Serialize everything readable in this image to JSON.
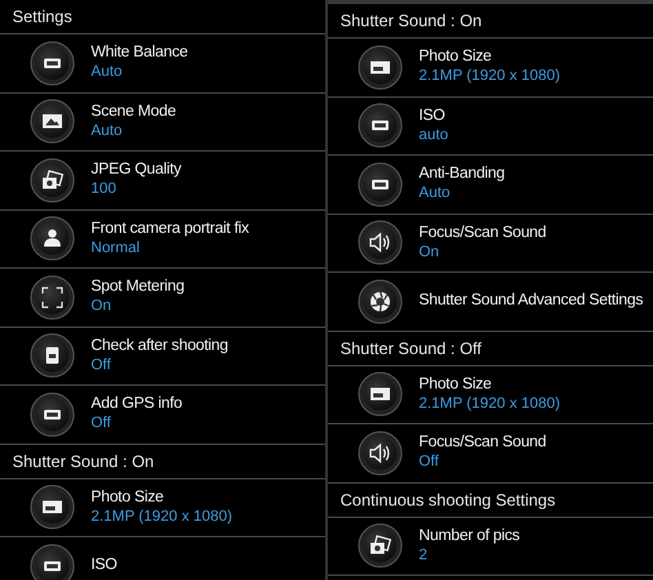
{
  "panels": [
    {
      "entries": [
        {
          "kind": "header",
          "title": "Settings"
        },
        {
          "kind": "item",
          "title": "White Balance",
          "value": "Auto"
        },
        {
          "kind": "item",
          "title": "Scene Mode",
          "value": "Auto"
        },
        {
          "kind": "item",
          "title": "JPEG Quality",
          "value": "100"
        },
        {
          "kind": "item",
          "title": "Front camera portrait fix",
          "value": "Normal"
        },
        {
          "kind": "item",
          "title": "Spot Metering",
          "value": "On"
        },
        {
          "kind": "item",
          "title": "Check after shooting",
          "value": "Off"
        },
        {
          "kind": "item",
          "title": "Add GPS info",
          "value": "Off"
        },
        {
          "kind": "header",
          "title": "Shutter Sound : On"
        },
        {
          "kind": "item",
          "title": "Photo Size",
          "value": "2.1MP (1920 x 1080)"
        },
        {
          "kind": "item",
          "title": "ISO"
        }
      ]
    },
    {
      "entries": [
        {
          "kind": "header",
          "title": "Shutter Sound : On"
        },
        {
          "kind": "item",
          "title": "Photo Size",
          "value": "2.1MP (1920 x 1080)"
        },
        {
          "kind": "item",
          "title": "ISO",
          "value": "auto"
        },
        {
          "kind": "item",
          "title": "Anti-Banding",
          "value": "Auto"
        },
        {
          "kind": "item",
          "title": "Focus/Scan Sound",
          "value": "On"
        },
        {
          "kind": "item",
          "title": "Shutter Sound Advanced Settings"
        },
        {
          "kind": "header",
          "title": "Shutter Sound : Off"
        },
        {
          "kind": "item",
          "title": "Photo Size",
          "value": "2.1MP (1920 x 1080)"
        },
        {
          "kind": "item",
          "title": "Focus/Scan Sound",
          "value": "Off"
        },
        {
          "kind": "header",
          "title": "Continuous shooting Settings"
        },
        {
          "kind": "item",
          "title": "Number of pics",
          "value": "2"
        }
      ]
    }
  ]
}
